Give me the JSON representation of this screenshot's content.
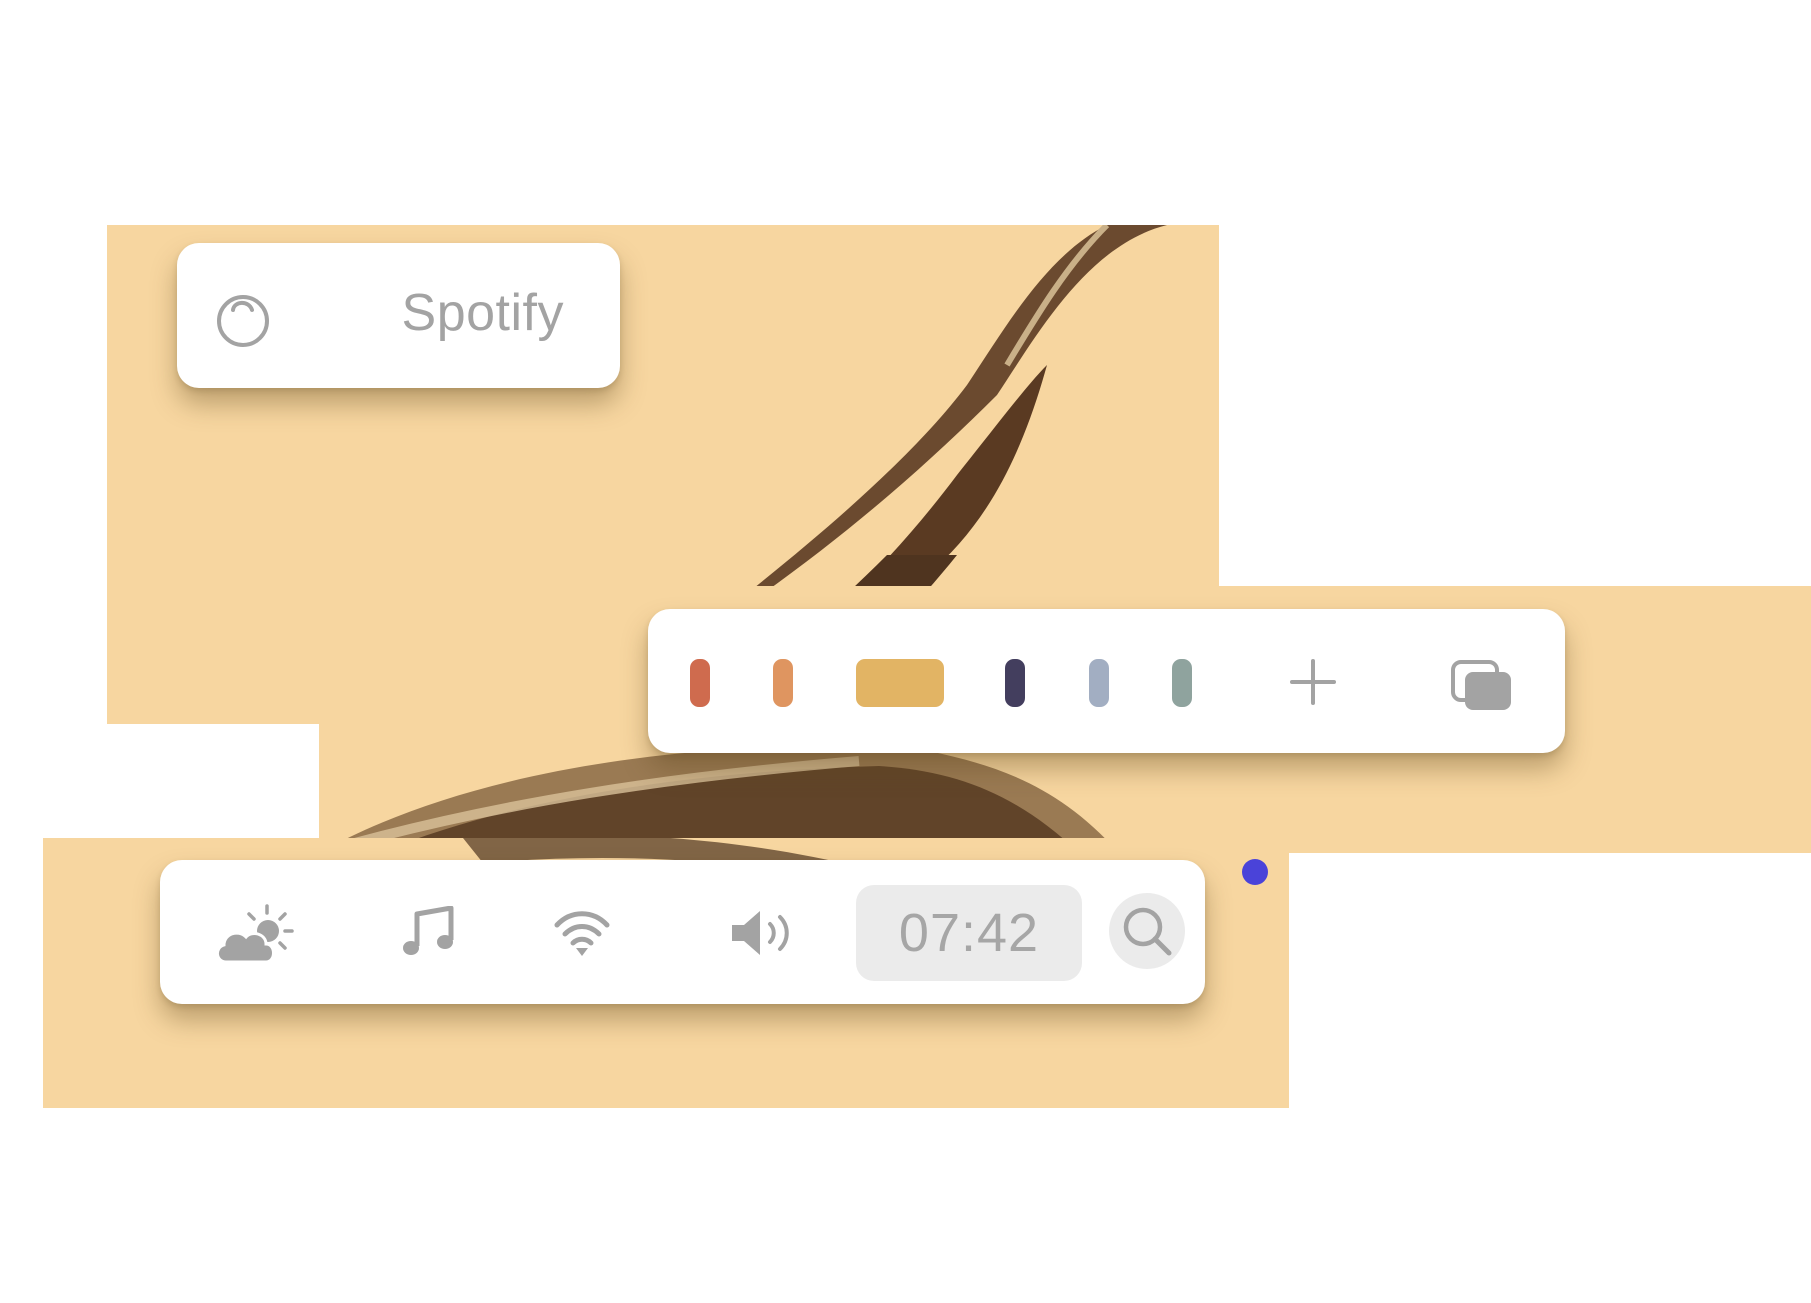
{
  "app_menu": {
    "icon": "timer-icon",
    "label": "Spotify"
  },
  "palette": {
    "swatches": [
      {
        "name": "rust",
        "color": "#cf6b4e",
        "selected": false
      },
      {
        "name": "orange",
        "color": "#df9560",
        "selected": false
      },
      {
        "name": "gold",
        "color": "#e2b464",
        "selected": true
      },
      {
        "name": "navy",
        "color": "#433e5e",
        "selected": false
      },
      {
        "name": "slate-blue",
        "color": "#a2aec2",
        "selected": false
      },
      {
        "name": "sage",
        "color": "#8fa39e",
        "selected": false
      }
    ],
    "add_icon": "plus-icon",
    "copy_icon": "copy-icon"
  },
  "status_bar": {
    "icons": [
      "partly-cloudy-icon",
      "music-note-icon",
      "wifi-icon",
      "volume-icon"
    ],
    "clock": "07:42",
    "search_icon": "search-icon"
  },
  "colors": {
    "wallpaper": "#f7d6a0",
    "icon_gray": "#a3a3a3",
    "dot": "#4a43d9"
  }
}
